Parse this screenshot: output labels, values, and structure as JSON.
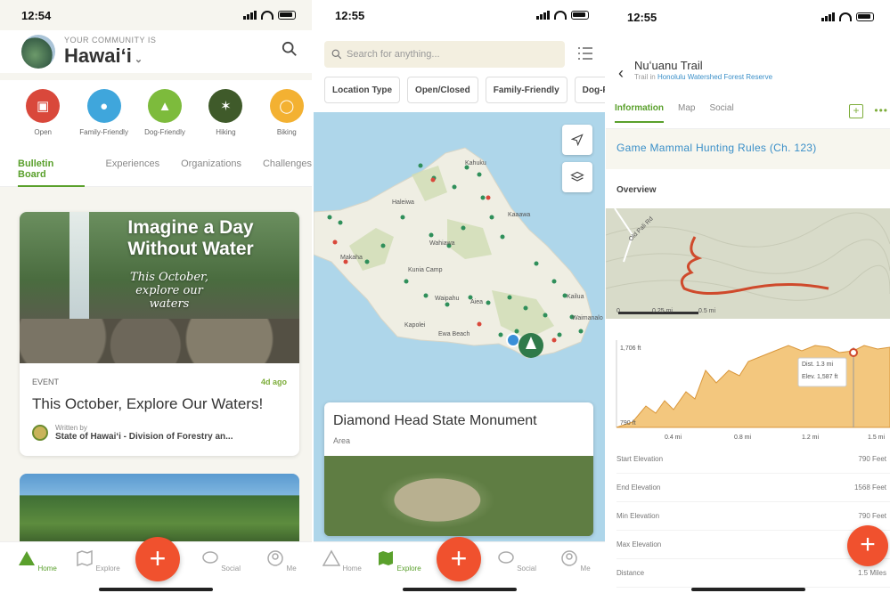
{
  "colors": {
    "green": "#5aa02c",
    "fab": "#f0512e",
    "link": "#3a8fc8"
  },
  "phone1": {
    "time": "12:54",
    "community_label": "YOUR COMMUNITY IS",
    "community_name": "Hawaiʻi",
    "categories": [
      {
        "label": "Open",
        "color": "#d9483b",
        "icon": "briefcase-icon"
      },
      {
        "label": "Family-Friendly",
        "color": "#3fa6dc",
        "icon": "stroller-icon"
      },
      {
        "label": "Dog-Friendly",
        "color": "#7dbb3c",
        "icon": "dog-icon"
      },
      {
        "label": "Hiking",
        "color": "#3f5a2a",
        "icon": "hiker-icon"
      },
      {
        "label": "Biking",
        "color": "#f3b132",
        "icon": "bike-icon"
      }
    ],
    "tabs": [
      "Bulletin Board",
      "Experiences",
      "Organizations",
      "Challenges"
    ],
    "card": {
      "hero_title": "Imagine a Day Without Water",
      "hero_subtitle": "This October, explore our waters",
      "tag": "EVENT",
      "ago": "4d ago",
      "title": "This October, Explore Our Waters!",
      "written_by": "Written by",
      "org": "State of Hawaiʻi - Division of Forestry an..."
    },
    "nav": [
      "Home",
      "Explore",
      "Social",
      "Me"
    ]
  },
  "phone2": {
    "time": "12:55",
    "search_placeholder": "Search for anything...",
    "filters": [
      "Location Type",
      "Open/Closed",
      "Family-Friendly",
      "Dog-F"
    ],
    "map_labels": [
      "Kahuku",
      "Haleiwa",
      "Kaaawa",
      "Wahiawa",
      "Makaha",
      "Kunia Camp",
      "Waipahu",
      "Aiea",
      "Kailua",
      "Kapolei",
      "Ewa Beach",
      "Waimanalo"
    ],
    "place_name": "Diamond Head State Monument",
    "place_type": "Area",
    "nav": [
      "Home",
      "Explore",
      "Social",
      "Me"
    ]
  },
  "phone3": {
    "time": "12:55",
    "trail_name": "Nuʻuanu Trail",
    "trail_in": "Trail in",
    "reserve": "Honolulu Watershed Forest Reserve",
    "tabs": [
      "Information",
      "Map",
      "Social"
    ],
    "rules_link": "Game Mammal Hunting Rules (Ch. 123)",
    "overview": "Overview",
    "map_road": "Old Pali Rd",
    "scale": [
      "0",
      "0.25 mi",
      "0.5 mi"
    ],
    "chart": {
      "max_label": "1,706 ft",
      "min_label": "790 ft",
      "ticks": [
        "0.4 mi",
        "0.8 mi",
        "1.2 mi",
        "1.5 mi"
      ],
      "tooltip_dist": "Dist. 1.3 mi",
      "tooltip_elev": "Elev. 1,587 ft"
    },
    "stats": [
      {
        "label": "Start Elevation",
        "value": "790 Feet"
      },
      {
        "label": "End Elevation",
        "value": "1568 Feet"
      },
      {
        "label": "Min Elevation",
        "value": "790 Feet"
      },
      {
        "label": "Max Elevation",
        "value": ""
      },
      {
        "label": "Distance",
        "value": "1.5 Miles"
      }
    ]
  }
}
